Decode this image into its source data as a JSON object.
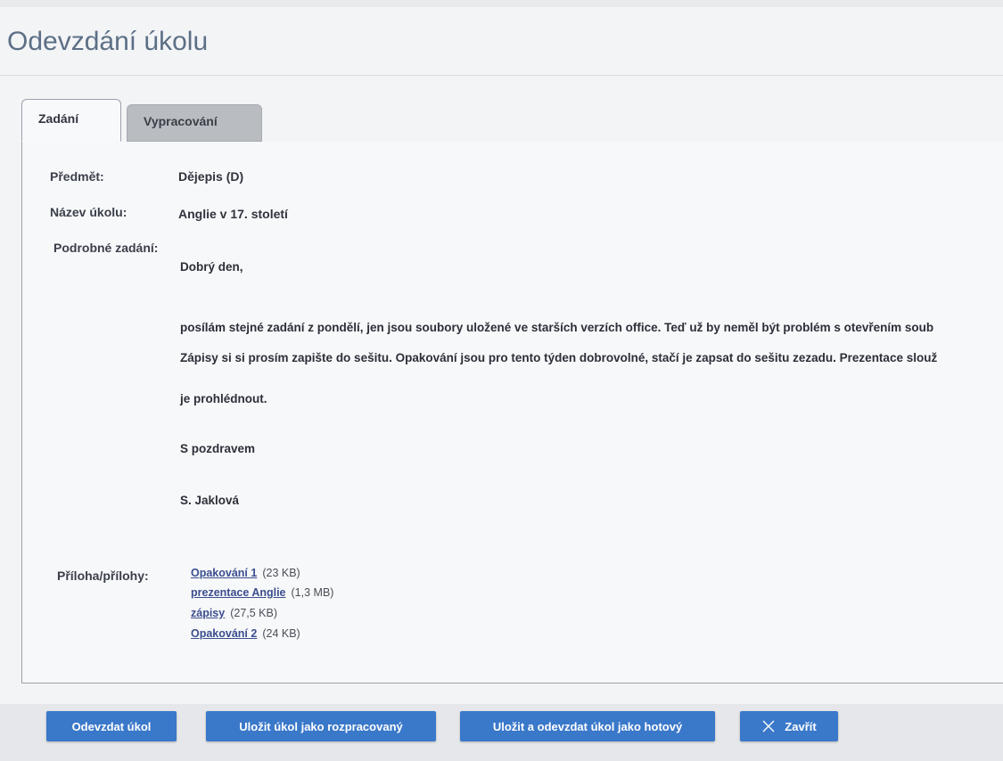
{
  "page": {
    "title": "Odevzdání úkolu"
  },
  "tabs": [
    {
      "label": "Zadání",
      "active": true
    },
    {
      "label": "Vypracování",
      "active": false
    }
  ],
  "fields": {
    "subject_label": "Předmět:",
    "subject_value": "Dějepis (D)",
    "task_name_label": "Název úkolu:",
    "task_name_value": "Anglie v 17. století",
    "details_label": "Podrobné zadání:"
  },
  "details": [
    "Dobrý den,",
    "posílám stejné zadání z pondělí, jen jsou soubory uložené ve starších verzích office. Teď už by neměl být problém s otevřením soub",
    "Zápisy si si prosím zapište do sešitu. Opakování jsou pro tento týden dobrovolné, stačí je zapsat do sešitu zezadu. Prezentace slouž",
    "je prohlédnout.",
    "S pozdravem",
    "S. Jaklová"
  ],
  "attachments": {
    "label": "Příloha/přílohy:",
    "items": [
      {
        "name": "Opakování 1",
        "size": "(23 KB)"
      },
      {
        "name": "prezentace Anglie",
        "size": "(1,3 MB)"
      },
      {
        "name": "zápisy",
        "size": "(27,5 KB)"
      },
      {
        "name": "Opakování 2",
        "size": "(24 KB)"
      }
    ]
  },
  "buttons": {
    "submit": "Odevzdat úkol",
    "save_draft": "Uložit úkol jako rozpracovaný",
    "save_submit_done": "Uložit a odevzdat úkol jako hotový",
    "close": "Zavřít"
  },
  "colors": {
    "title": "#5c6f86",
    "button_bg": "#3a78c9",
    "link": "#3b4e8e",
    "inactive_tab": "#b9bcc1"
  }
}
